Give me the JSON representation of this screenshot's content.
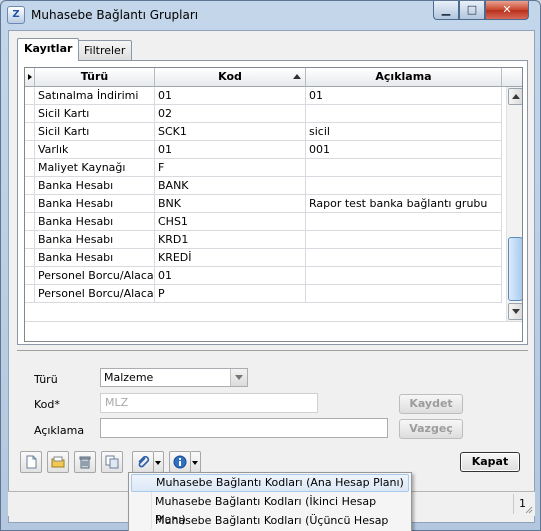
{
  "window": {
    "title": "Muhasebe Bağlantı Grupları",
    "min_glyph": "▁",
    "max_glyph": "□",
    "close_glyph": "✕",
    "app_icon_glyph": "Z"
  },
  "tabs": [
    {
      "label": "Kayıtlar"
    },
    {
      "label": "Filtreler"
    }
  ],
  "grid": {
    "columns": [
      {
        "label": "Türü"
      },
      {
        "label": "Kod"
      },
      {
        "label": "Açıklama"
      }
    ],
    "rows": [
      {
        "tur": "Satınalma İndirimi",
        "kod": "01",
        "aciklama": "01"
      },
      {
        "tur": "Sicil Kartı",
        "kod": "02",
        "aciklama": ""
      },
      {
        "tur": "Sicil Kartı",
        "kod": "SCK1",
        "aciklama": "sicil"
      },
      {
        "tur": "Varlık",
        "kod": "01",
        "aciklama": "001"
      },
      {
        "tur": "Maliyet Kaynağı",
        "kod": "F",
        "aciklama": ""
      },
      {
        "tur": "Banka Hesabı",
        "kod": "BANK",
        "aciklama": ""
      },
      {
        "tur": "Banka Hesabı",
        "kod": "BNK",
        "aciklama": "Rapor test banka bağlantı grubu"
      },
      {
        "tur": "Banka Hesabı",
        "kod": "CHS1",
        "aciklama": ""
      },
      {
        "tur": "Banka Hesabı",
        "kod": "KRD1",
        "aciklama": ""
      },
      {
        "tur": "Banka Hesabı",
        "kod": "KREDİ",
        "aciklama": ""
      },
      {
        "tur": "Personel Borcu/Alacağı",
        "kod": "01",
        "aciklama": ""
      },
      {
        "tur": "Personel Borcu/Alacağı",
        "kod": "P",
        "aciklama": ""
      }
    ]
  },
  "form": {
    "turu_label": "Türü",
    "turu_value": "Malzeme",
    "kod_label": "Kod*",
    "kod_value": "MLZ",
    "aciklama_label": "Açıklama",
    "aciklama_value": "",
    "kaydet_label": "Kaydet",
    "vazgec_label": "Vazgeç",
    "kapat_label": "Kapat"
  },
  "dropdown_menu": {
    "items": [
      {
        "label": "Muhasebe Bağlantı Kodları (Ana Hesap Planı)"
      },
      {
        "label": "Muhasebe Bağlantı Kodları (İkinci Hesap Planı)"
      },
      {
        "label": "Muhasebe Bağlantı Kodları (Üçüncü Hesap Planı)"
      }
    ]
  },
  "statusbar": {
    "count": "1"
  },
  "colors": {
    "title_bar": "#c4d6ea",
    "close_button": "#c9452c",
    "accent": "#a8c8ec"
  }
}
